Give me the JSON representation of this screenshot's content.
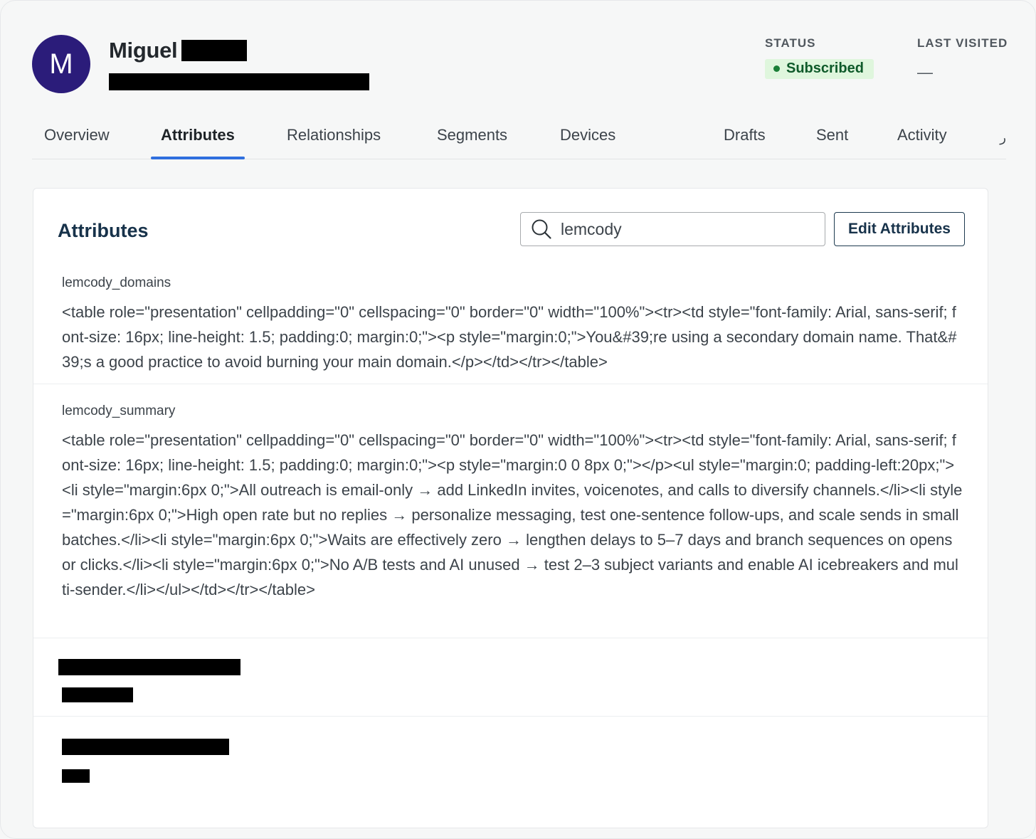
{
  "profile": {
    "avatar_initial": "M",
    "first_name": "Miguel",
    "status_label": "STATUS",
    "status_value": "Subscribed",
    "last_visited_label": "LAST VISITED",
    "last_visited_value": "—"
  },
  "tabs": [
    {
      "label": "Overview"
    },
    {
      "label": "Attributes"
    },
    {
      "label": "Relationships"
    },
    {
      "label": "Segments"
    },
    {
      "label": "Devices"
    },
    {
      "label": "Drafts"
    },
    {
      "label": "Sent"
    },
    {
      "label": "Activity"
    }
  ],
  "tab_overflow": "ر",
  "card": {
    "title": "Attributes",
    "search_value": "lemcody",
    "edit_button": "Edit Attributes"
  },
  "attributes": [
    {
      "key": "lemcody_domains",
      "value": "<table role=\"presentation\" cellpadding=\"0\" cellspacing=\"0\" border=\"0\" width=\"100%\"><tr><td style=\"font-family: Arial, sans-serif; font-size: 16px; line-height: 1.5; padding:0; margin:0;\"><p style=\"margin:0;\">You&#39;re using a secondary domain name. That&#39;s a good practice to avoid burning your main domain.</p></td></tr></table>"
    },
    {
      "key": "lemcody_summary",
      "value": "<table role=\"presentation\" cellpadding=\"0\" cellspacing=\"0\" border=\"0\" width=\"100%\"><tr><td style=\"font-family: Arial, sans-serif; font-size: 16px; line-height: 1.5; padding:0; margin:0;\"><p style=\"margin:0 0 8px 0;\"></p><ul style=\"margin:0; padding-left:20px;\"><li style=\"margin:6px 0;\">All outreach is email-only → add LinkedIn invites, voicenotes, and calls to diversify channels.</li><li style=\"margin:6px 0;\">High open rate but no replies → personalize messaging, test one-sentence follow-ups, and scale sends in small batches.</li><li style=\"margin:6px 0;\">Waits are effectively zero → lengthen delays to 5–7 days and branch sequences on opens or clicks.</li><li style=\"margin:6px 0;\">No A/B tests and AI unused → test 2–3 subject variants and enable AI icebreakers and multi-sender.</li></ul></td></tr></table>"
    }
  ]
}
